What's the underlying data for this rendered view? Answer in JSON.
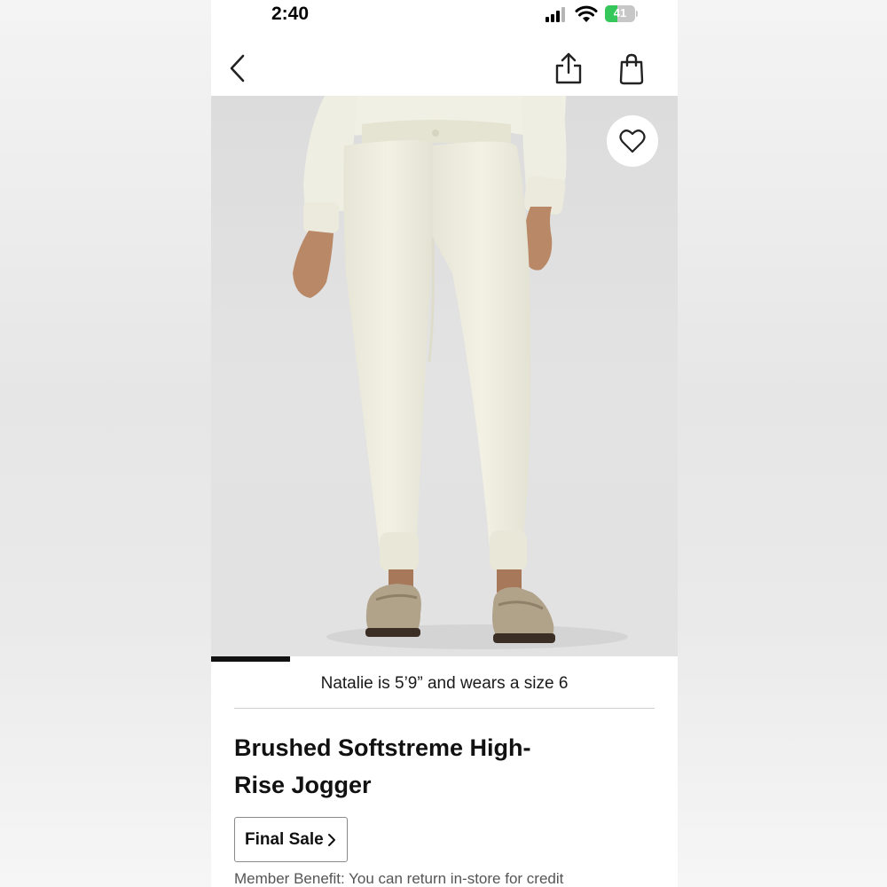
{
  "status_bar": {
    "time": "2:40",
    "battery_level": "41",
    "battery_fraction": 0.41,
    "icons": [
      "signal-icon",
      "wifi-icon",
      "battery-icon"
    ]
  },
  "nav": {
    "icons": [
      "back-icon",
      "share-icon",
      "shopping-bag-icon"
    ]
  },
  "product_image": {
    "favorite_icon": "heart-icon",
    "carousel_progress": 0.17
  },
  "model_info": "Natalie is 5’9” and wears a size 6",
  "product": {
    "title_line1": "Brushed Softstreme High-",
    "title_line2": "Rise Jogger",
    "final_sale_label": "Final Sale",
    "member_benefit": "Member Benefit: You can return in-store for credit"
  },
  "colors": {
    "battery_green": "#35c759",
    "progress_bar": "#111111",
    "garment": "#efeee0",
    "photo_background": "#e0e0e0"
  }
}
